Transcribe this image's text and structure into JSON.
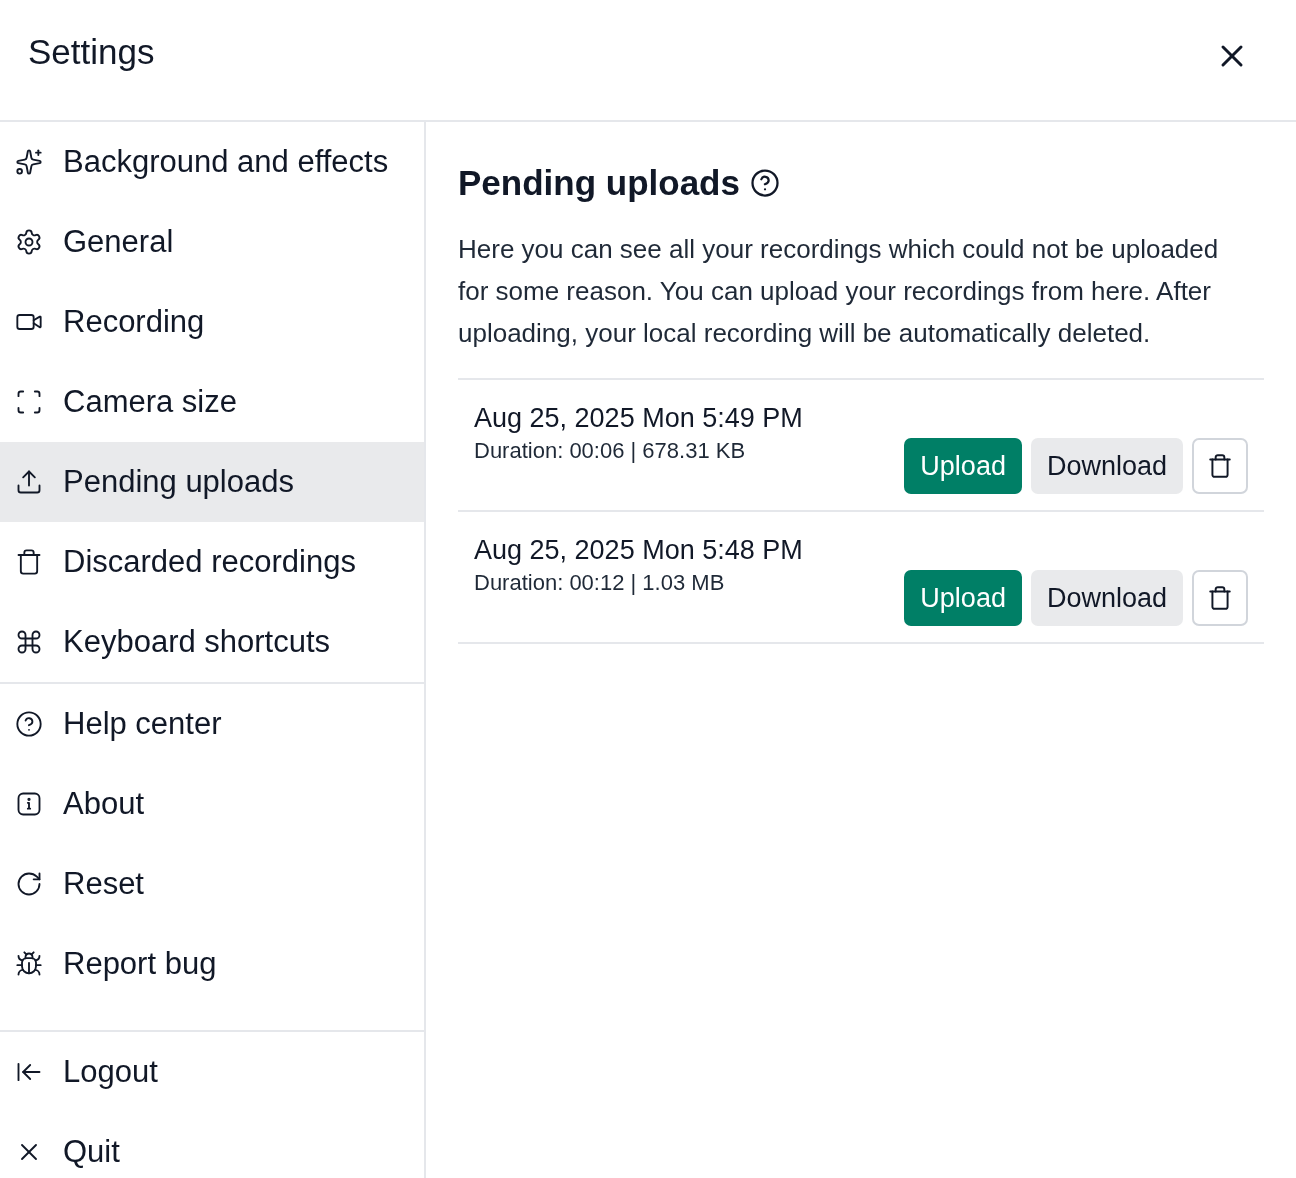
{
  "window": {
    "title": "Settings"
  },
  "sidebar": {
    "groups": [
      {
        "items": [
          {
            "label": "Background and effects",
            "selected": false
          },
          {
            "label": "General",
            "selected": false
          },
          {
            "label": "Recording",
            "selected": false
          },
          {
            "label": "Camera size",
            "selected": false
          },
          {
            "label": "Pending uploads",
            "selected": true
          },
          {
            "label": "Discarded recordings",
            "selected": false
          },
          {
            "label": "Keyboard shortcuts",
            "selected": false
          }
        ]
      },
      {
        "items": [
          {
            "label": "Help center",
            "selected": false
          },
          {
            "label": "About",
            "selected": false
          },
          {
            "label": "Reset",
            "selected": false
          },
          {
            "label": "Report bug",
            "selected": false
          }
        ]
      },
      {
        "items": [
          {
            "label": "Logout",
            "selected": false
          },
          {
            "label": "Quit",
            "selected": false
          }
        ]
      }
    ]
  },
  "content": {
    "title": "Pending uploads",
    "description": "Here you can see all your recordings which could not be uploaded for some reason. You can upload your recordings from here. After uploading, your local recording will be automatically deleted.",
    "recordings": [
      {
        "date": "Aug 25, 2025 Mon 5:49 PM",
        "details": "Duration: 00:06 | 678.31 KB",
        "upload": "Upload",
        "download": "Download"
      },
      {
        "date": "Aug 25, 2025 Mon 5:48 PM",
        "details": "Duration: 00:12 | 1.03 MB",
        "upload": "Upload",
        "download": "Download"
      }
    ]
  }
}
